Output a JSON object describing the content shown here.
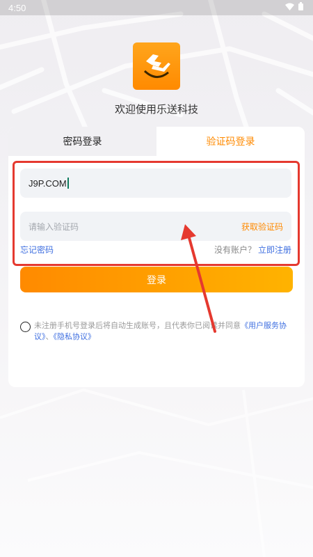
{
  "status_bar": {
    "time": "4:50",
    "icons": [
      "wifi-icon",
      "battery-icon"
    ]
  },
  "app": {
    "logo": "app-logo",
    "welcome": "欢迎使用乐送科技"
  },
  "tabs": [
    {
      "label": "密码登录",
      "active": false
    },
    {
      "label": "验证码登录",
      "active": true
    }
  ],
  "form": {
    "phone_value": "J9P.COM",
    "code_placeholder": "请输入验证码",
    "get_code_label": "获取验证码",
    "forgot_label": "忘记密码",
    "no_account_label": "没有账户？",
    "register_label": "立即注册",
    "login_label": "登录"
  },
  "agreement": {
    "prefix": "未注册手机号登录后将自动生成账号，且代表你已阅读并同意",
    "user_agreement": "《用户服务协议》",
    "separator": "、",
    "privacy": "《隐私协议》",
    "checked": false
  },
  "colors": {
    "accent": "#ff8a00",
    "link": "#3f6fe0",
    "annotation": "#e5392f"
  }
}
